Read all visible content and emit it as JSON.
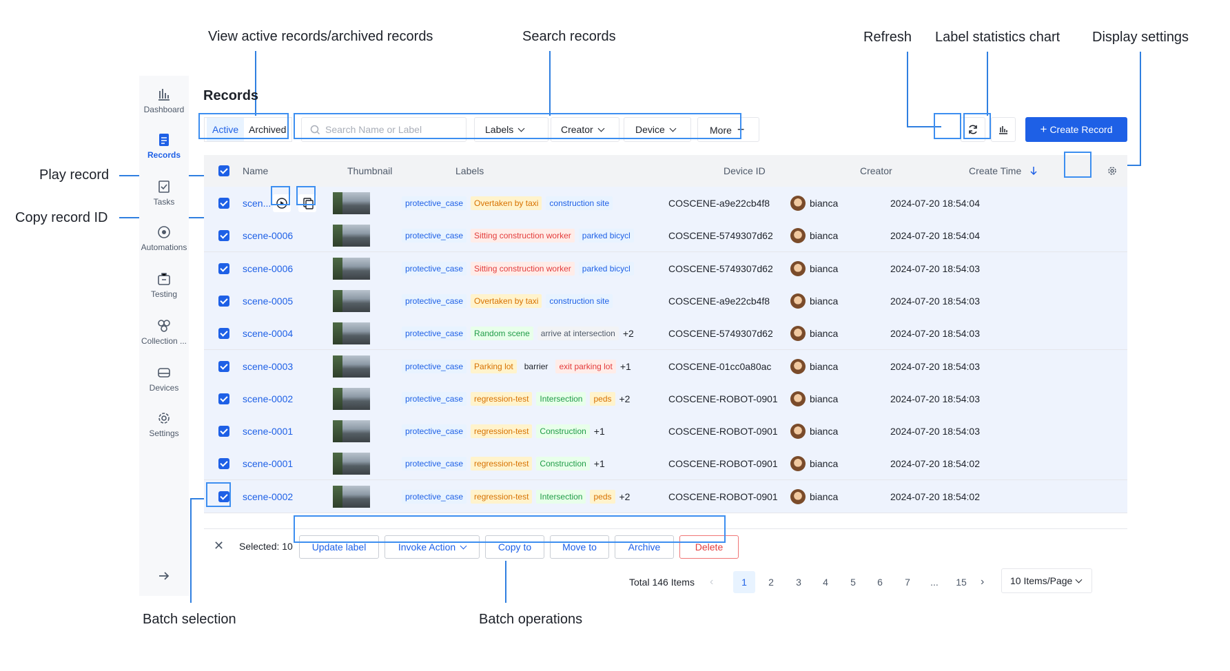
{
  "annotations": {
    "view_active": "View active records/archived records",
    "search": "Search records",
    "refresh": "Refresh",
    "label_stats": "Label statistics chart",
    "display_settings": "Display settings",
    "play_record": "Play record",
    "copy_record_id": "Copy record ID",
    "batch_selection": "Batch selection",
    "batch_operations": "Batch operations"
  },
  "sidebar": {
    "items": [
      {
        "label": "Dashboard",
        "icon": "bar-chart-icon"
      },
      {
        "label": "Records",
        "icon": "document-icon"
      },
      {
        "label": "Tasks",
        "icon": "task-icon"
      },
      {
        "label": "Automations",
        "icon": "automation-icon"
      },
      {
        "label": "Testing",
        "icon": "testing-icon"
      },
      {
        "label": "Collection ...",
        "icon": "collection-icon"
      },
      {
        "label": "Devices",
        "icon": "device-icon"
      },
      {
        "label": "Settings",
        "icon": "gear-icon"
      }
    ],
    "active_index": 1
  },
  "header": {
    "title": "Records",
    "tabs": [
      "Active",
      "Archived"
    ],
    "search_placeholder": "Search Name or Label",
    "filters": [
      "Labels",
      "Creator",
      "Device",
      "More"
    ],
    "create_label": "Create Record"
  },
  "table": {
    "columns": [
      "Name",
      "Thumbnail",
      "Labels",
      "Device ID",
      "Creator",
      "Create Time"
    ],
    "rows": [
      {
        "name": "scen...",
        "labels": [
          [
            "protective_case",
            "blue"
          ],
          [
            "Overtaken by taxi",
            "orange"
          ],
          [
            "construction site",
            "blue"
          ]
        ],
        "extra": "",
        "device": "COSCENE-a9e22cb4f8",
        "creator": "bianca",
        "time": "2024-07-20 18:54:04"
      },
      {
        "name": "scene-0006",
        "labels": [
          [
            "protective_case",
            "blue"
          ],
          [
            "Sitting construction worker",
            "red"
          ],
          [
            "parked bicycl",
            "blue"
          ]
        ],
        "extra": "",
        "device": "COSCENE-5749307d62",
        "creator": "bianca",
        "time": "2024-07-20 18:54:04"
      },
      {
        "name": "scene-0006",
        "labels": [
          [
            "protective_case",
            "blue"
          ],
          [
            "Sitting construction worker",
            "red"
          ],
          [
            "parked bicycl",
            "blue"
          ]
        ],
        "extra": "",
        "device": "COSCENE-5749307d62",
        "creator": "bianca",
        "time": "2024-07-20 18:54:03"
      },
      {
        "name": "scene-0005",
        "labels": [
          [
            "protective_case",
            "blue"
          ],
          [
            "Overtaken by taxi",
            "orange"
          ],
          [
            "construction site",
            "blue"
          ]
        ],
        "extra": "",
        "device": "COSCENE-a9e22cb4f8",
        "creator": "bianca",
        "time": "2024-07-20 18:54:03"
      },
      {
        "name": "scene-0004",
        "labels": [
          [
            "protective_case",
            "blue"
          ],
          [
            "Random scene",
            "green"
          ],
          [
            "arrive at intersection",
            "gray"
          ]
        ],
        "extra": "+2",
        "device": "COSCENE-5749307d62",
        "creator": "bianca",
        "time": "2024-07-20 18:54:03"
      },
      {
        "name": "scene-0003",
        "labels": [
          [
            "protective_case",
            "blue"
          ],
          [
            "Parking lot",
            "orange"
          ],
          [
            "barrier",
            "plain"
          ],
          [
            "exit parking lot",
            "red"
          ]
        ],
        "extra": "+1",
        "device": "COSCENE-01cc0a80ac",
        "creator": "bianca",
        "time": "2024-07-20 18:54:03"
      },
      {
        "name": "scene-0002",
        "labels": [
          [
            "protective_case",
            "blue"
          ],
          [
            "regression-test",
            "orange"
          ],
          [
            "Intersection",
            "green"
          ],
          [
            "peds",
            "orange"
          ]
        ],
        "extra": "+2",
        "device": "COSCENE-ROBOT-0901",
        "creator": "bianca",
        "time": "2024-07-20 18:54:03"
      },
      {
        "name": "scene-0001",
        "labels": [
          [
            "protective_case",
            "blue"
          ],
          [
            "regression-test",
            "orange"
          ],
          [
            "Construction",
            "green"
          ]
        ],
        "extra": "+1",
        "device": "COSCENE-ROBOT-0901",
        "creator": "bianca",
        "time": "2024-07-20 18:54:03"
      },
      {
        "name": "scene-0001",
        "labels": [
          [
            "protective_case",
            "blue"
          ],
          [
            "regression-test",
            "orange"
          ],
          [
            "Construction",
            "green"
          ]
        ],
        "extra": "+1",
        "device": "COSCENE-ROBOT-0901",
        "creator": "bianca",
        "time": "2024-07-20 18:54:02"
      },
      {
        "name": "scene-0002",
        "labels": [
          [
            "protective_case",
            "blue"
          ],
          [
            "regression-test",
            "orange"
          ],
          [
            "Intersection",
            "green"
          ],
          [
            "peds",
            "orange"
          ]
        ],
        "extra": "+2",
        "device": "COSCENE-ROBOT-0901",
        "creator": "bianca",
        "time": "2024-07-20 18:54:02"
      }
    ]
  },
  "batch": {
    "selected_text": "Selected: 10",
    "buttons": [
      "Update label",
      "Invoke Action",
      "Copy to",
      "Move to",
      "Archive",
      "Delete"
    ]
  },
  "pagination": {
    "total": "Total 146 Items",
    "pages": [
      "1",
      "2",
      "3",
      "4",
      "5",
      "6",
      "7",
      "...",
      "15"
    ],
    "current": "1",
    "page_size": "10 Items/Page"
  },
  "colors": {
    "accent": "#1e60e6",
    "danger": "#e33b3b",
    "highlight": "#3c8ef0"
  }
}
